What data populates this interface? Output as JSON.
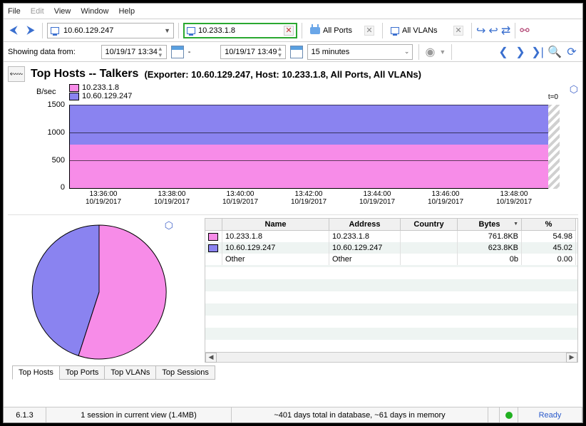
{
  "menu": {
    "file": "File",
    "edit": "Edit",
    "view": "View",
    "window": "Window",
    "help": "Help"
  },
  "toolbar1": {
    "exporter_combo": "10.60.129.247",
    "host_pill": "10.233.1.8",
    "ports_pill": "All Ports",
    "vlans_pill": "All VLANs"
  },
  "toolbar2": {
    "label": "Showing data from:",
    "from": "10/19/17 13:34",
    "dash": "-",
    "to": "10/19/17 13:49",
    "range": "15 minutes"
  },
  "title": {
    "main": "Top Hosts -- Talkers",
    "sub": "(Exporter: 10.60.129.247, Host: 10.233.1.8, All Ports, All VLANs)"
  },
  "legend": {
    "h1": "10.233.1.8",
    "h2": "10.60.129.247"
  },
  "chart": {
    "yunit": "B/sec",
    "t0": "t=0"
  },
  "chart_data": {
    "type": "area",
    "stacked": true,
    "ylabel": "B/sec",
    "ylim": [
      0,
      1500
    ],
    "yticks": [
      0,
      500,
      1000,
      1500
    ],
    "x_times": [
      "13:36:00",
      "13:38:00",
      "13:40:00",
      "13:42:00",
      "13:44:00",
      "13:46:00",
      "13:48:00"
    ],
    "x_date": "10/19/2017",
    "series": [
      {
        "name": "10.233.1.8",
        "color": "#f78ce8",
        "values": [
          800,
          800,
          800,
          800,
          800,
          800,
          800
        ]
      },
      {
        "name": "10.60.129.247",
        "color": "#8a83f0",
        "values": [
          700,
          700,
          700,
          700,
          700,
          700,
          700
        ]
      }
    ],
    "pie": {
      "type": "pie",
      "slices": [
        {
          "name": "10.233.1.8",
          "value": 54.98,
          "color": "#f78ce8"
        },
        {
          "name": "10.60.129.247",
          "value": 45.02,
          "color": "#8a83f0"
        }
      ]
    }
  },
  "table": {
    "columns": {
      "swatch": "",
      "name": "Name",
      "addr": "Address",
      "country": "Country",
      "bytes": "Bytes",
      "pct": "%"
    },
    "rows": [
      {
        "swatch": "pink",
        "name": "10.233.1.8",
        "addr": "10.233.1.8",
        "country": "",
        "bytes": "761.8KB",
        "pct": "54.98"
      },
      {
        "swatch": "purple",
        "name": "10.60.129.247",
        "addr": "10.60.129.247",
        "country": "",
        "bytes": "623.8KB",
        "pct": "45.02"
      },
      {
        "swatch": "",
        "name": "Other",
        "addr": "Other",
        "country": "",
        "bytes": "0b",
        "pct": "0.00"
      }
    ]
  },
  "tabs": {
    "t1": "Top Hosts",
    "t2": "Top Ports",
    "t3": "Top VLANs",
    "t4": "Top Sessions"
  },
  "status": {
    "ver": "6.1.3",
    "sess": "1 session in current view (1.4MB)",
    "db": "~401 days total in database,  ~61 days in memory",
    "ready": "Ready"
  }
}
